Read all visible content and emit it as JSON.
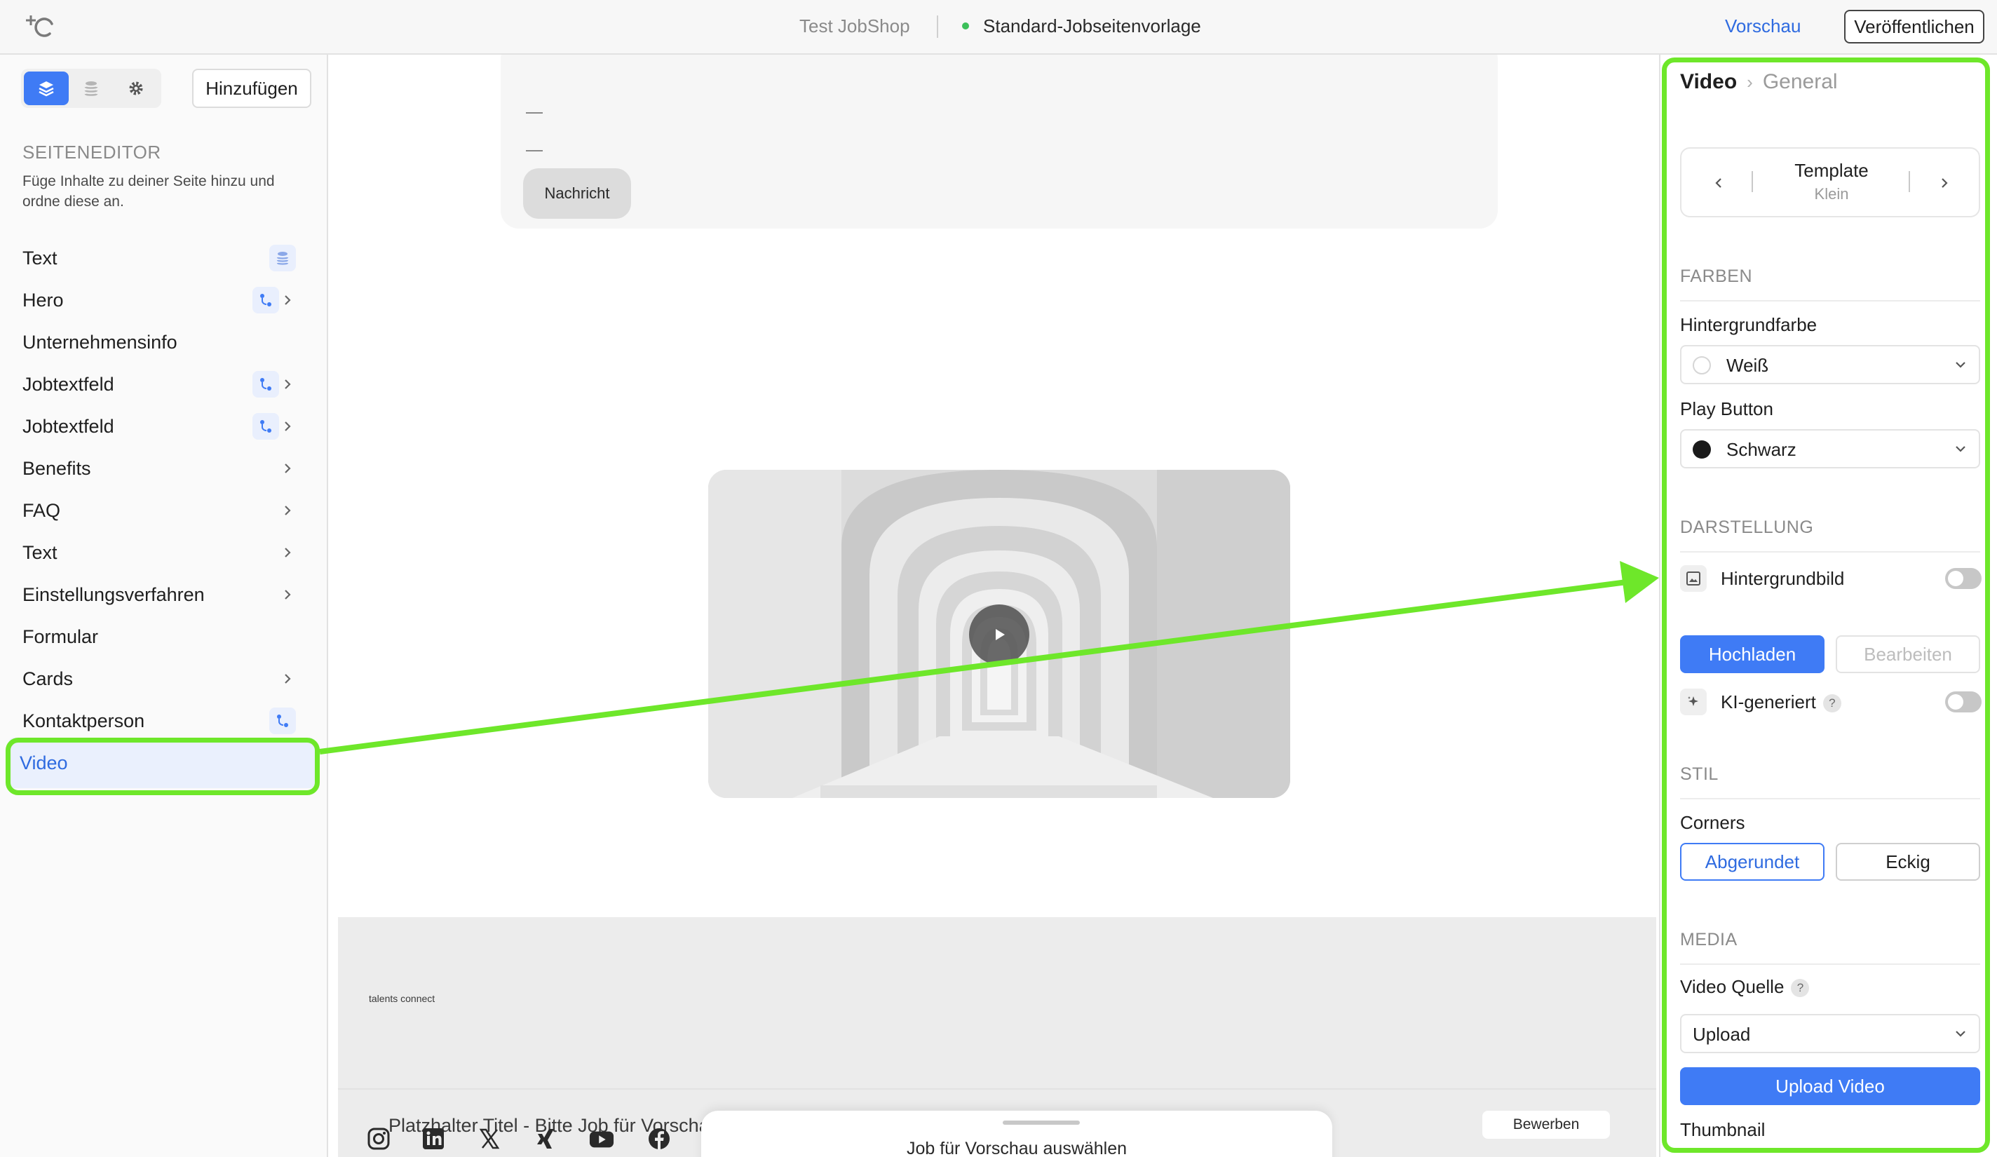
{
  "topbar": {
    "project": "Test JobShop",
    "template": "Standard-Jobseitenvorlage",
    "preview": "Vorschau",
    "publish": "Veröffentlichen",
    "status_color": "#3cc05a"
  },
  "sidebar": {
    "tabs": [
      "layers-icon",
      "database-icon",
      "gear-icon"
    ],
    "add_button": "Hinzufügen",
    "section_title": "SEITENEDITOR",
    "section_desc": "Füge Inhalte zu deiner Seite hinzu und ordne diese an.",
    "items": [
      {
        "label": "Text",
        "badge": "database-icon",
        "chevron": false
      },
      {
        "label": "Hero",
        "badge": "connect-icon",
        "chevron": true
      },
      {
        "label": "Unternehmensinfo",
        "badge": "",
        "chevron": false
      },
      {
        "label": "Jobtextfeld",
        "badge": "connect-icon",
        "chevron": true
      },
      {
        "label": "Jobtextfeld",
        "badge": "connect-icon",
        "chevron": true
      },
      {
        "label": "Benefits",
        "badge": "",
        "chevron": true
      },
      {
        "label": "FAQ",
        "badge": "",
        "chevron": true
      },
      {
        "label": "Text",
        "badge": "",
        "chevron": true
      },
      {
        "label": "Einstellungsverfahren",
        "badge": "",
        "chevron": true
      },
      {
        "label": "Formular",
        "badge": "",
        "chevron": false
      },
      {
        "label": "Cards",
        "badge": "",
        "chevron": true
      },
      {
        "label": "Kontaktperson",
        "badge": "connect-icon",
        "chevron": false
      },
      {
        "label": "Video",
        "badge": "",
        "chevron": false,
        "active": true
      }
    ]
  },
  "canvas": {
    "message_button": "Nachricht",
    "footer_logo": "talents connect",
    "footer_title": "Platzhalter Titel - Bitte Job für Vorschau auswählen",
    "apply_button": "Bewerben",
    "social_icons": [
      "instagram-icon",
      "linkedin-icon",
      "x-icon",
      "xing-icon",
      "youtube-icon",
      "facebook-icon"
    ],
    "job_sheet": "Job für Vorschau auswählen"
  },
  "panel": {
    "breadcrumb": {
      "section": "Video",
      "page": "General"
    },
    "template": {
      "label": "Template",
      "value": "Klein"
    },
    "farben": {
      "heading": "FARBEN",
      "bg_label": "Hintergrundfarbe",
      "bg_value": "Weiß",
      "bg_swatch": "#ffffff",
      "play_label": "Play Button",
      "play_value": "Schwarz",
      "play_swatch": "#1a1a1a"
    },
    "darstellung": {
      "heading": "DARSTELLUNG",
      "bgimage_label": "Hintergrundbild",
      "bgimage_on": false,
      "upload": "Hochladen",
      "edit": "Bearbeiten",
      "ai_label": "KI-generiert",
      "ai_on": false,
      "help": "?"
    },
    "stil": {
      "heading": "STIL",
      "corners_label": "Corners",
      "rounded": "Abgerundet",
      "square": "Eckig",
      "selected": "Abgerundet"
    },
    "media": {
      "heading": "MEDIA",
      "source_label": "Video Quelle",
      "help": "?",
      "source_value": "Upload",
      "upload_video": "Upload Video",
      "thumbnail_label": "Thumbnail"
    }
  },
  "colors": {
    "accent": "#3f7bf5",
    "highlight": "#6ee72a"
  }
}
